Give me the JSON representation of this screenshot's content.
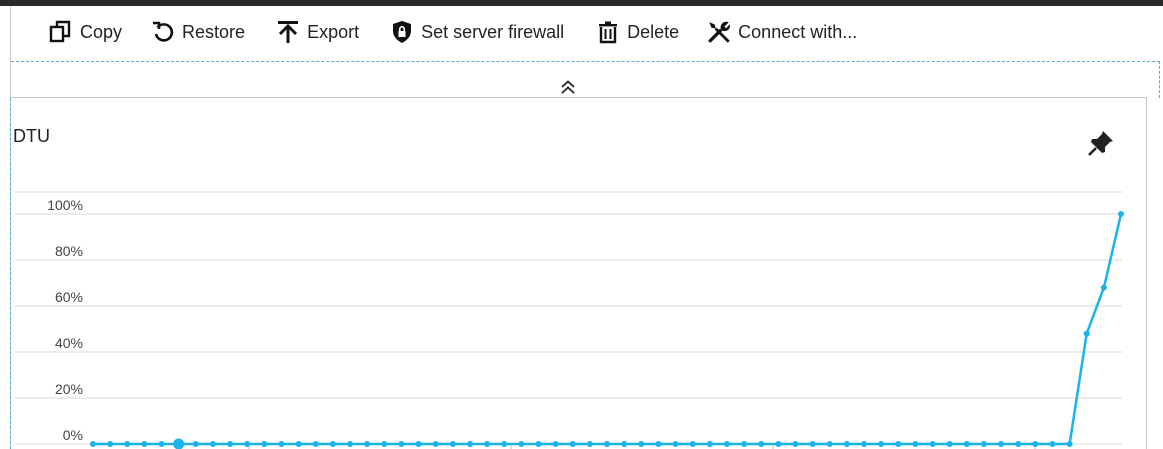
{
  "toolbar": {
    "items": [
      {
        "label": "Copy",
        "icon": "copy-icon"
      },
      {
        "label": "Restore",
        "icon": "restore-icon"
      },
      {
        "label": "Export",
        "icon": "export-icon"
      },
      {
        "label": "Set server firewall",
        "icon": "shield-lock-icon"
      },
      {
        "label": "Delete",
        "icon": "trash-icon"
      },
      {
        "label": "Connect with...",
        "icon": "tools-icon"
      }
    ]
  },
  "panel": {
    "title": "DTU",
    "collapse_icon": "double-chevron-up-icon",
    "pin_icon": "pin-icon"
  },
  "colors": {
    "series": "#1ab3ea",
    "grid": "#d9d9d9",
    "topbar": "#2a2a2a"
  },
  "chart_data": {
    "type": "line",
    "title": "DTU",
    "ylim": [
      0,
      100
    ],
    "y_ticks": [
      "0%",
      "20%",
      "40%",
      "60%",
      "80%",
      "100%"
    ],
    "grid": true,
    "series": [
      {
        "values": [
          0,
          0,
          0,
          0,
          0,
          0,
          0,
          0,
          0,
          0,
          0,
          0,
          0,
          0,
          0,
          0,
          0,
          0,
          0,
          0,
          0,
          0,
          0,
          0,
          0,
          0,
          0,
          0,
          0,
          0,
          0,
          0,
          0,
          0,
          0,
          0,
          0,
          0,
          0,
          0,
          0,
          0,
          0,
          0,
          0,
          0,
          0,
          0,
          0,
          0,
          0,
          0,
          0,
          0,
          0,
          0,
          0,
          0,
          48,
          68,
          100
        ]
      }
    ]
  }
}
